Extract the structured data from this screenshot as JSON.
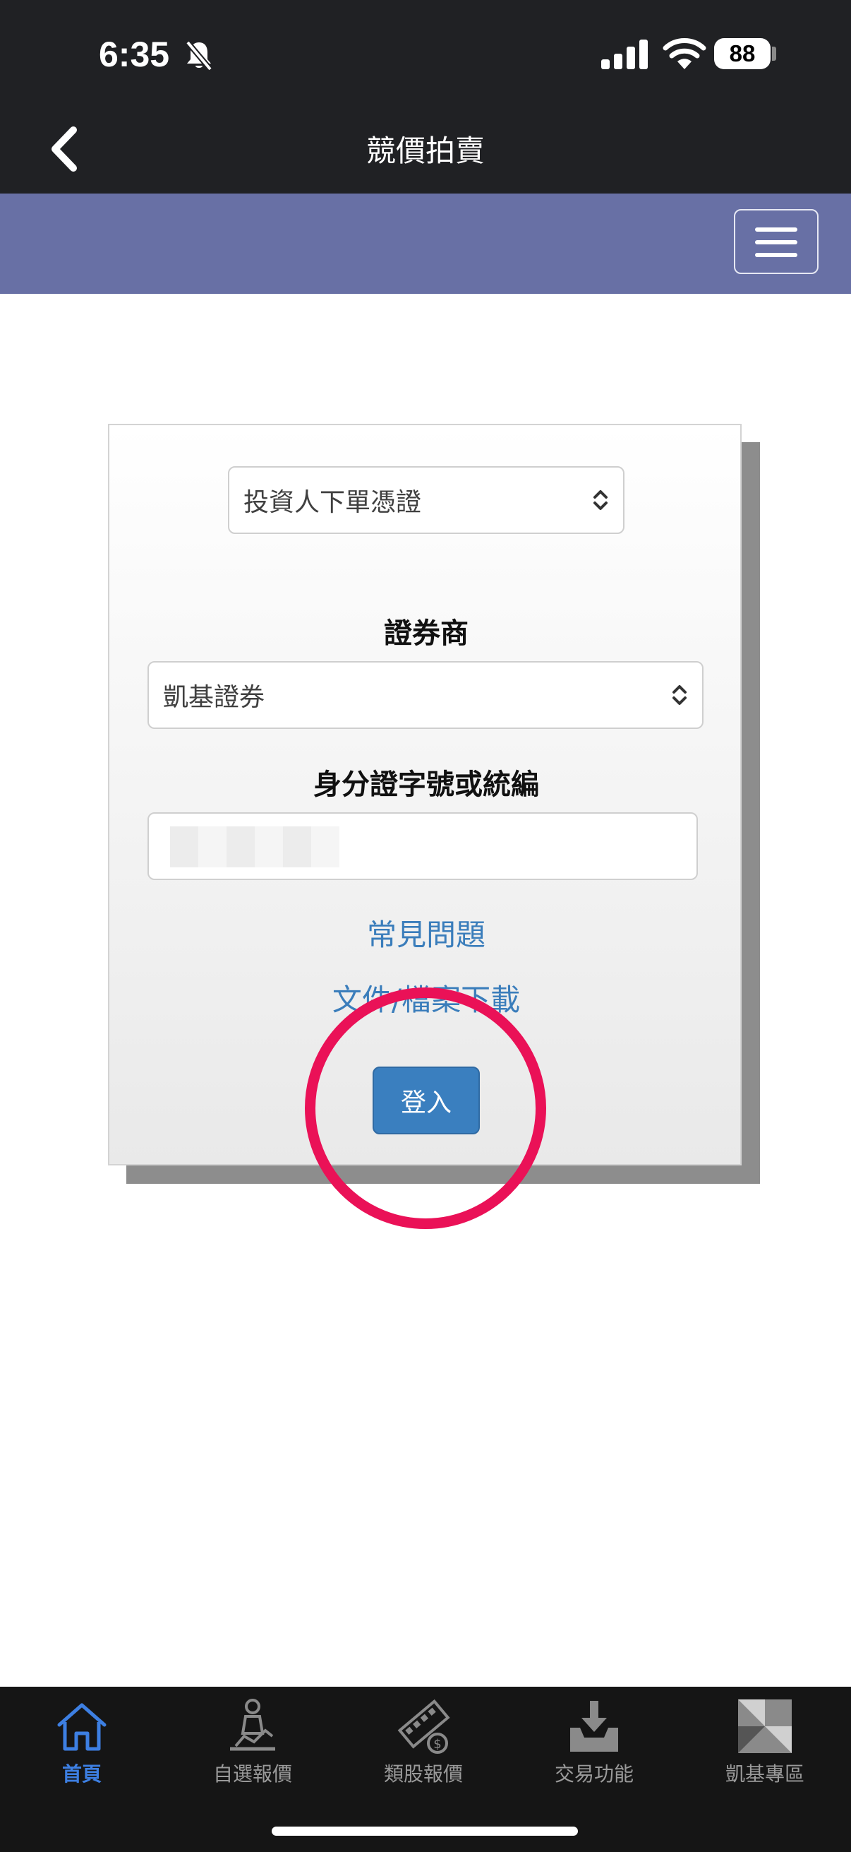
{
  "status": {
    "time": "6:35",
    "battery": "88"
  },
  "nav": {
    "title": "競價拍賣"
  },
  "form": {
    "credential_select": "投資人下單憑證",
    "broker_label": "證券商",
    "broker_select": "凱基證券",
    "id_label": "身分證字號或統編",
    "faq_link": "常見問題",
    "download_link": "文件/檔案下載",
    "login_button": "登入"
  },
  "tabs": [
    {
      "label": "首頁",
      "icon": "home-icon",
      "active": true
    },
    {
      "label": "自選報價",
      "icon": "person-chart-icon"
    },
    {
      "label": "類股報價",
      "icon": "film-money-icon"
    },
    {
      "label": "交易功能",
      "icon": "download-tray-icon"
    },
    {
      "label": "凱基專區",
      "icon": "kgi-logo-icon"
    }
  ],
  "colors": {
    "accent_blue": "#3a7fbf",
    "banner_purple": "#6870a5",
    "highlight_red": "#ea1157"
  }
}
